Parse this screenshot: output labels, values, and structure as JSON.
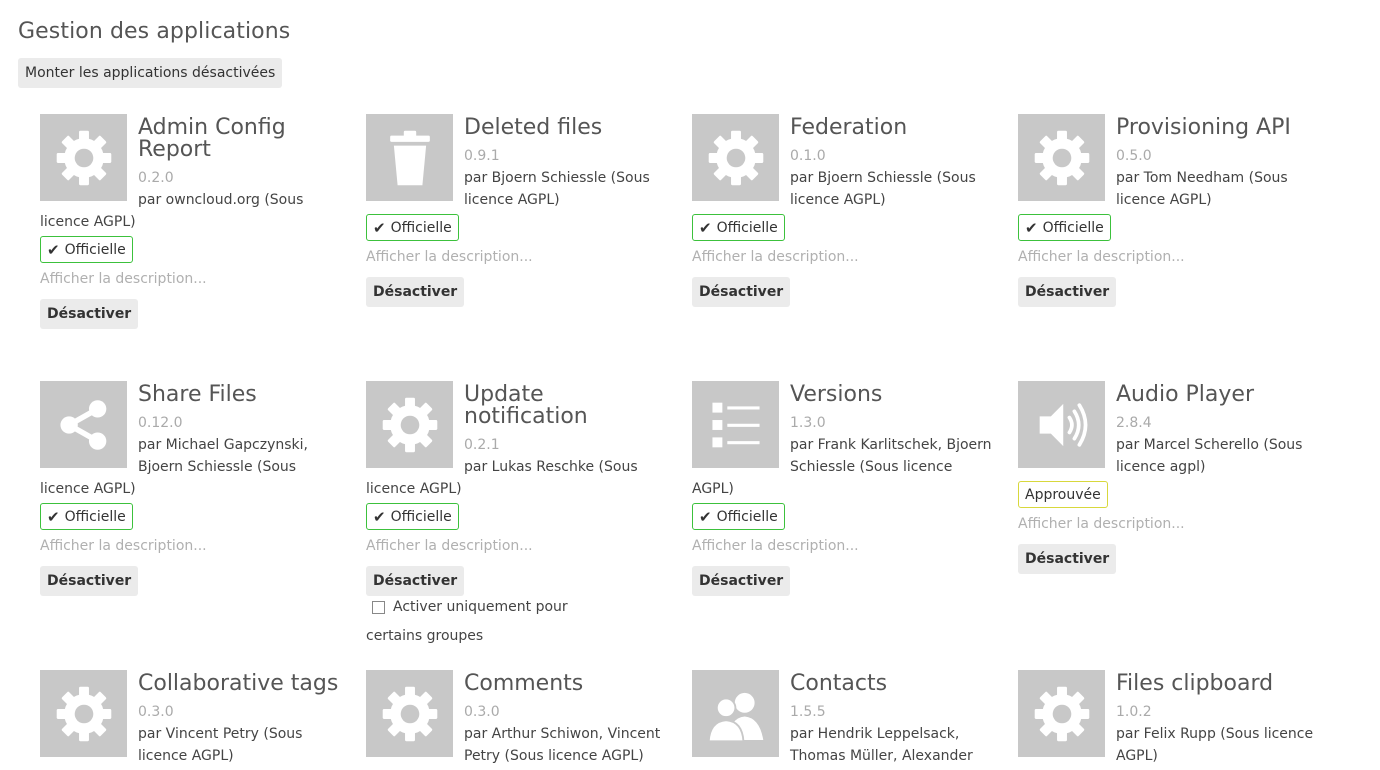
{
  "header": {
    "title": "Gestion des applications",
    "show_disabled_label": "Monter les applications désactivées"
  },
  "labels": {
    "official": "Officielle",
    "approved": "Approuvée",
    "show_description": "Afficher la description...",
    "disable": "Désactiver",
    "groups_toggle": "Activer uniquement pour",
    "groups_toggle_cont": "certains groupes"
  },
  "apps": [
    {
      "name": "Admin Config Report",
      "version": "0.2.0",
      "author": "par owncloud.org (Sous licence AGPL)",
      "icon": "gear-icon",
      "badge": "official"
    },
    {
      "name": "Deleted files",
      "version": "0.9.1",
      "author": "par Bjoern Schiessle (Sous licence AGPL)",
      "icon": "trash-icon",
      "badge": "official"
    },
    {
      "name": "Federation",
      "version": "0.1.0",
      "author": "par Bjoern Schiessle (Sous licence AGPL)",
      "icon": "gear-icon",
      "badge": "official"
    },
    {
      "name": "Provisioning API",
      "version": "0.5.0",
      "author": "par Tom Needham (Sous licence AGPL)",
      "icon": "gear-icon",
      "badge": "official"
    },
    {
      "name": "Share Files",
      "version": "0.12.0",
      "author": "par Michael Gapczynski, Bjoern Schiessle (Sous licence AGPL)",
      "icon": "share-icon",
      "badge": "official"
    },
    {
      "name": "Update notification",
      "version": "0.2.1",
      "author": "par Lukas Reschke (Sous licence AGPL)",
      "icon": "gear-icon",
      "badge": "official"
    },
    {
      "name": "Versions",
      "version": "1.3.0",
      "author": "par Frank Karlitschek, Bjoern Schiessle (Sous licence AGPL)",
      "icon": "list-icon",
      "badge": "official"
    },
    {
      "name": "Audio Player",
      "version": "2.8.4",
      "author": "par Marcel Scherello (Sous licence agpl)",
      "icon": "speaker-icon",
      "badge": "approved"
    },
    {
      "name": "Collaborative tags",
      "version": "0.3.0",
      "author": "par Vincent Petry (Sous licence AGPL)",
      "icon": "gear-icon"
    },
    {
      "name": "Comments",
      "version": "0.3.0",
      "author": "par Arthur Schiwon, Vincent Petry (Sous licence AGPL)",
      "icon": "gear-icon"
    },
    {
      "name": "Contacts",
      "version": "1.5.5",
      "author": "par Hendrik Leppelsack, Thomas Müller, Alexander",
      "icon": "contacts-icon"
    },
    {
      "name": "Files clipboard",
      "version": "1.0.2",
      "author": "par Felix Rupp (Sous licence AGPL)",
      "icon": "gear-icon"
    }
  ]
}
